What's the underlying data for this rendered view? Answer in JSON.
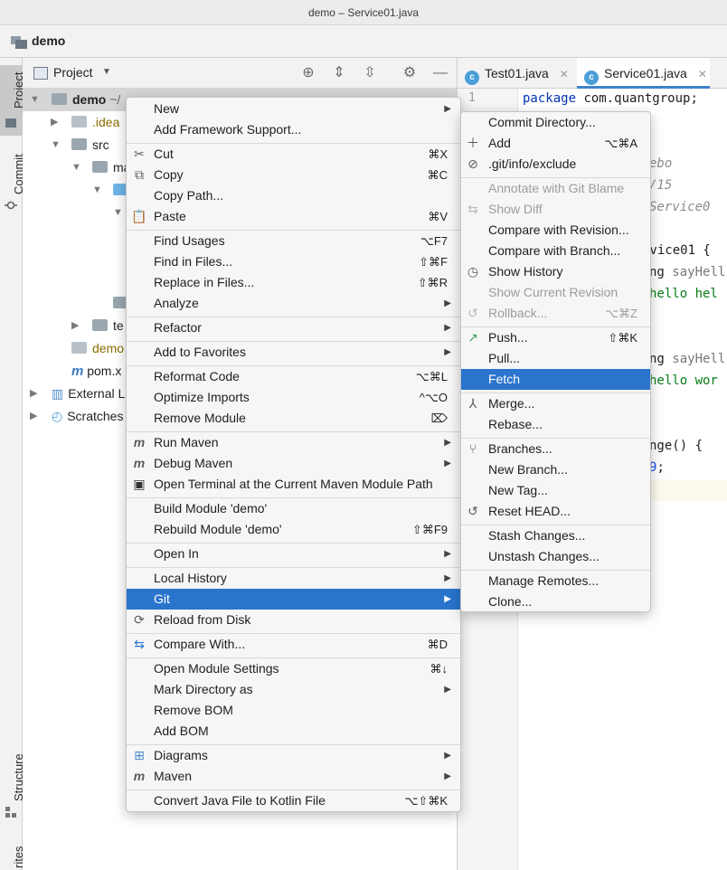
{
  "window": {
    "title": "demo – Service01.java"
  },
  "navbar": {
    "project": "demo"
  },
  "toolstrip": {
    "project": "Project",
    "commit": "Commit",
    "structure": "Structure",
    "favorites": "rites"
  },
  "panel": {
    "title": "Project"
  },
  "tree": {
    "root": "demo",
    "root_path": "~/",
    "idea": ".idea",
    "src": "src",
    "main": "ma",
    "test": "te",
    "iml": "demo",
    "pom": "pom.x",
    "ext": "External L",
    "scratches": "Scratches"
  },
  "editor": {
    "tabs": [
      {
        "label": "Test01.java"
      },
      {
        "label": "Service01.java"
      }
    ],
    "line1": "1",
    "code": {
      "l1_kw": "package",
      "l1_rest": " com.quantgroup;",
      "l2": "ebo",
      "l3": "/15",
      "l4": "Service0",
      "l5": "rvice01 {",
      "l6_a": "ng ",
      "l6_b": "sayHell",
      "l7_a": "hello hel",
      "l8_a": "ng ",
      "l8_b": "sayHell",
      "l9_a": "hello wor",
      "l10_a": "nge() {",
      "l11_a": "9",
      "l11_b": ";"
    }
  },
  "menu": {
    "new": "New",
    "add_framework": "Add Framework Support...",
    "cut": "Cut",
    "cut_sc": "⌘X",
    "copy": "Copy",
    "copy_sc": "⌘C",
    "copy_path": "Copy Path...",
    "paste": "Paste",
    "paste_sc": "⌘V",
    "find_usages": "Find Usages",
    "find_usages_sc": "⌥F7",
    "find_files": "Find in Files...",
    "find_files_sc": "⇧⌘F",
    "replace_files": "Replace in Files...",
    "replace_files_sc": "⇧⌘R",
    "analyze": "Analyze",
    "refactor": "Refactor",
    "add_favorites": "Add to Favorites",
    "reformat": "Reformat Code",
    "reformat_sc": "⌥⌘L",
    "optimize": "Optimize Imports",
    "optimize_sc": "^⌥O",
    "remove_module": "Remove Module",
    "remove_module_sc": "⌦",
    "run_maven": "Run Maven",
    "debug_maven": "Debug Maven",
    "open_terminal": "Open Terminal at the Current Maven Module Path",
    "build_module": "Build Module 'demo'",
    "rebuild_module": "Rebuild Module 'demo'",
    "rebuild_module_sc": "⇧⌘F9",
    "open_in": "Open In",
    "local_history": "Local History",
    "git": "Git",
    "reload": "Reload from Disk",
    "compare_with": "Compare With...",
    "compare_with_sc": "⌘D",
    "module_settings": "Open Module Settings",
    "module_settings_sc": "⌘↓",
    "mark_dir": "Mark Directory as",
    "remove_bom": "Remove BOM",
    "add_bom": "Add BOM",
    "diagrams": "Diagrams",
    "maven": "Maven",
    "convert_kotlin": "Convert Java File to Kotlin File",
    "convert_kotlin_sc": "⌥⇧⌘K"
  },
  "git_menu": {
    "commit_dir": "Commit Directory...",
    "add": "Add",
    "add_sc": "⌥⌘A",
    "exclude": ".git/info/exclude",
    "annotate": "Annotate with Git Blame",
    "show_diff": "Show Diff",
    "compare_revision": "Compare with Revision...",
    "compare_branch": "Compare with Branch...",
    "show_history": "Show History",
    "show_current": "Show Current Revision",
    "rollback": "Rollback...",
    "rollback_sc": "⌥⌘Z",
    "push": "Push...",
    "push_sc": "⇧⌘K",
    "pull": "Pull...",
    "fetch": "Fetch",
    "merge": "Merge...",
    "rebase": "Rebase...",
    "branches": "Branches...",
    "new_branch": "New Branch...",
    "new_tag": "New Tag...",
    "reset_head": "Reset HEAD...",
    "stash": "Stash Changes...",
    "unstash": "Unstash Changes...",
    "manage_remotes": "Manage Remotes...",
    "clone": "Clone..."
  },
  "colors": {
    "highlight": "#2a74cd",
    "menu_bg": "#f6f6f6",
    "keyword": "#0033b3",
    "string": "#067d17"
  }
}
